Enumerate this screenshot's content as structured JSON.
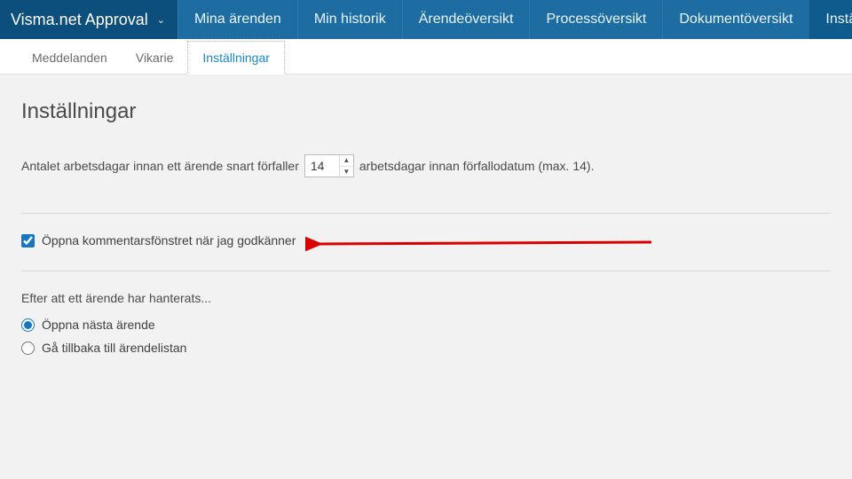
{
  "brand": {
    "title": "Visma.net Approval"
  },
  "nav": [
    {
      "label": "Mina ärenden"
    },
    {
      "label": "Min historik"
    },
    {
      "label": "Ärendeöversikt"
    },
    {
      "label": "Processöversikt"
    },
    {
      "label": "Dokumentöversikt"
    },
    {
      "label": "Inställningar"
    }
  ],
  "subtabs": [
    {
      "label": "Meddelanden"
    },
    {
      "label": "Vikarie"
    },
    {
      "label": "Inställningar"
    }
  ],
  "page": {
    "title": "Inställningar",
    "daysRow": {
      "before": "Antalet arbetsdagar innan ett ärende snart förfaller",
      "value": "14",
      "after": "arbetsdagar innan förfallodatum (max. 14)."
    },
    "cbLabel": "Öppna kommentarsfönstret när jag godkänner",
    "cbChecked": true,
    "afterHandled": {
      "heading": "Efter att ett ärende har hanterats...",
      "options": [
        "Öppna nästa ärende",
        "Gå tillbaka till ärendelistan"
      ],
      "selectedIndex": 0
    }
  }
}
